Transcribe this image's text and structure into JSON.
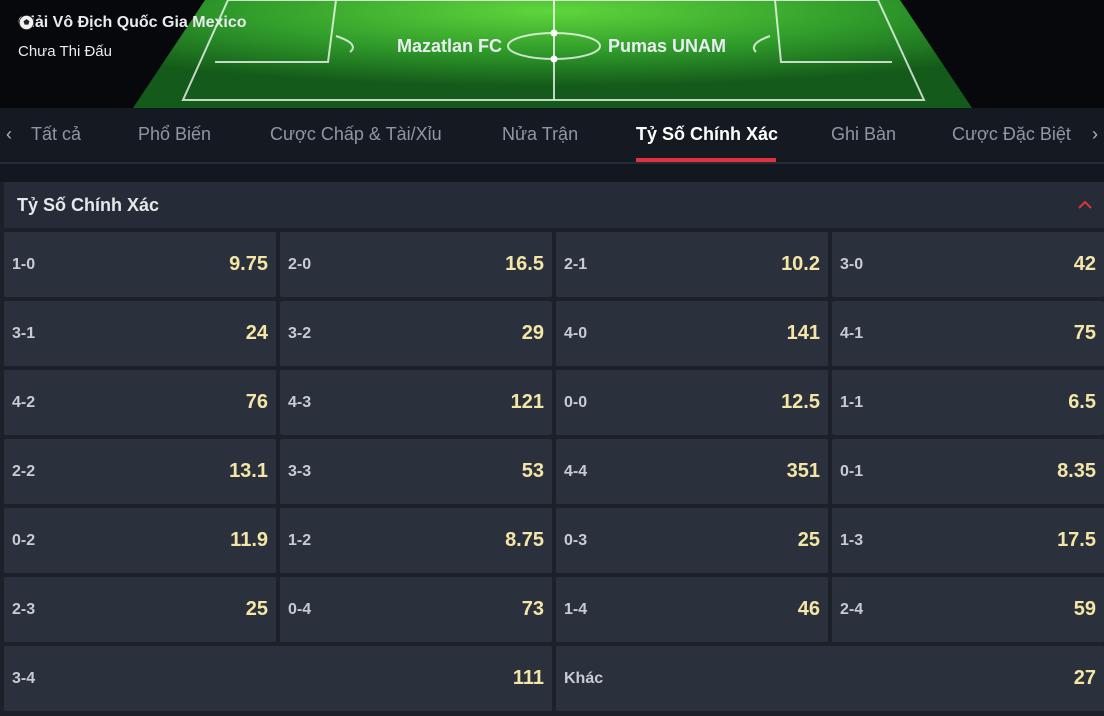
{
  "match": {
    "league": "Giải Vô Địch Quốc Gia Mexico",
    "status": "Chưa Thi Đấu",
    "home_team": "Mazatlan FC",
    "away_team": "Pumas UNAM"
  },
  "tabs": [
    {
      "label": "Tất cả",
      "active": false
    },
    {
      "label": "Phổ Biến",
      "active": false
    },
    {
      "label": "Cược Chấp & Tài/Xỉu",
      "active": false
    },
    {
      "label": "Nửa Trận",
      "active": false
    },
    {
      "label": "Tỷ Số Chính Xác",
      "active": true
    },
    {
      "label": "Ghi Bàn",
      "active": false
    },
    {
      "label": "Cược Đặc Biệt",
      "active": false
    }
  ],
  "nav": {
    "prev": "‹",
    "next": "›"
  },
  "section": {
    "title": "Tỷ Số Chính Xác"
  },
  "scores": [
    {
      "score": "1-0",
      "odd": "9.75"
    },
    {
      "score": "2-0",
      "odd": "16.5"
    },
    {
      "score": "2-1",
      "odd": "10.2"
    },
    {
      "score": "3-0",
      "odd": "42"
    },
    {
      "score": "3-1",
      "odd": "24"
    },
    {
      "score": "3-2",
      "odd": "29"
    },
    {
      "score": "4-0",
      "odd": "141"
    },
    {
      "score": "4-1",
      "odd": "75"
    },
    {
      "score": "4-2",
      "odd": "76"
    },
    {
      "score": "4-3",
      "odd": "121"
    },
    {
      "score": "0-0",
      "odd": "12.5"
    },
    {
      "score": "1-1",
      "odd": "6.5"
    },
    {
      "score": "2-2",
      "odd": "13.1"
    },
    {
      "score": "3-3",
      "odd": "53"
    },
    {
      "score": "4-4",
      "odd": "351"
    },
    {
      "score": "0-1",
      "odd": "8.35"
    },
    {
      "score": "0-2",
      "odd": "11.9"
    },
    {
      "score": "1-2",
      "odd": "8.75"
    },
    {
      "score": "0-3",
      "odd": "25"
    },
    {
      "score": "1-3",
      "odd": "17.5"
    },
    {
      "score": "2-3",
      "odd": "25"
    },
    {
      "score": "0-4",
      "odd": "73"
    },
    {
      "score": "1-4",
      "odd": "46"
    },
    {
      "score": "2-4",
      "odd": "59"
    },
    {
      "score": "3-4",
      "odd": "111"
    },
    {
      "score": "Khác",
      "odd": "27"
    }
  ],
  "colors": {
    "accent": "#e0323c",
    "odd_text": "#f4e6a6",
    "cell_bg": "#2b313c"
  }
}
